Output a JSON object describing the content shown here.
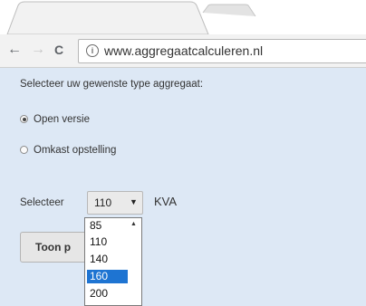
{
  "browser": {
    "url": "www.aggregaatcalculeren.nl",
    "back_glyph": "←",
    "forward_glyph": "→",
    "reload_glyph": "C",
    "info_glyph": "i"
  },
  "page": {
    "prompt": "Selecteer uw gewenste type aggregaat:",
    "options": [
      {
        "label": "Open versie",
        "checked": true
      },
      {
        "label": "Omkast opstelling",
        "checked": false
      }
    ],
    "select_label": "Selecteer",
    "select_value": "110",
    "select_caret": "▼",
    "unit": "KVA",
    "button_label": "Toon p",
    "dropdown_scroll_glyph": "▲",
    "dropdown_items": [
      "85",
      "110",
      "140",
      "160",
      "200"
    ],
    "dropdown_highlighted": "160"
  },
  "colors": {
    "content_bg": "#dde8f5",
    "highlight": "#1e74d2"
  }
}
